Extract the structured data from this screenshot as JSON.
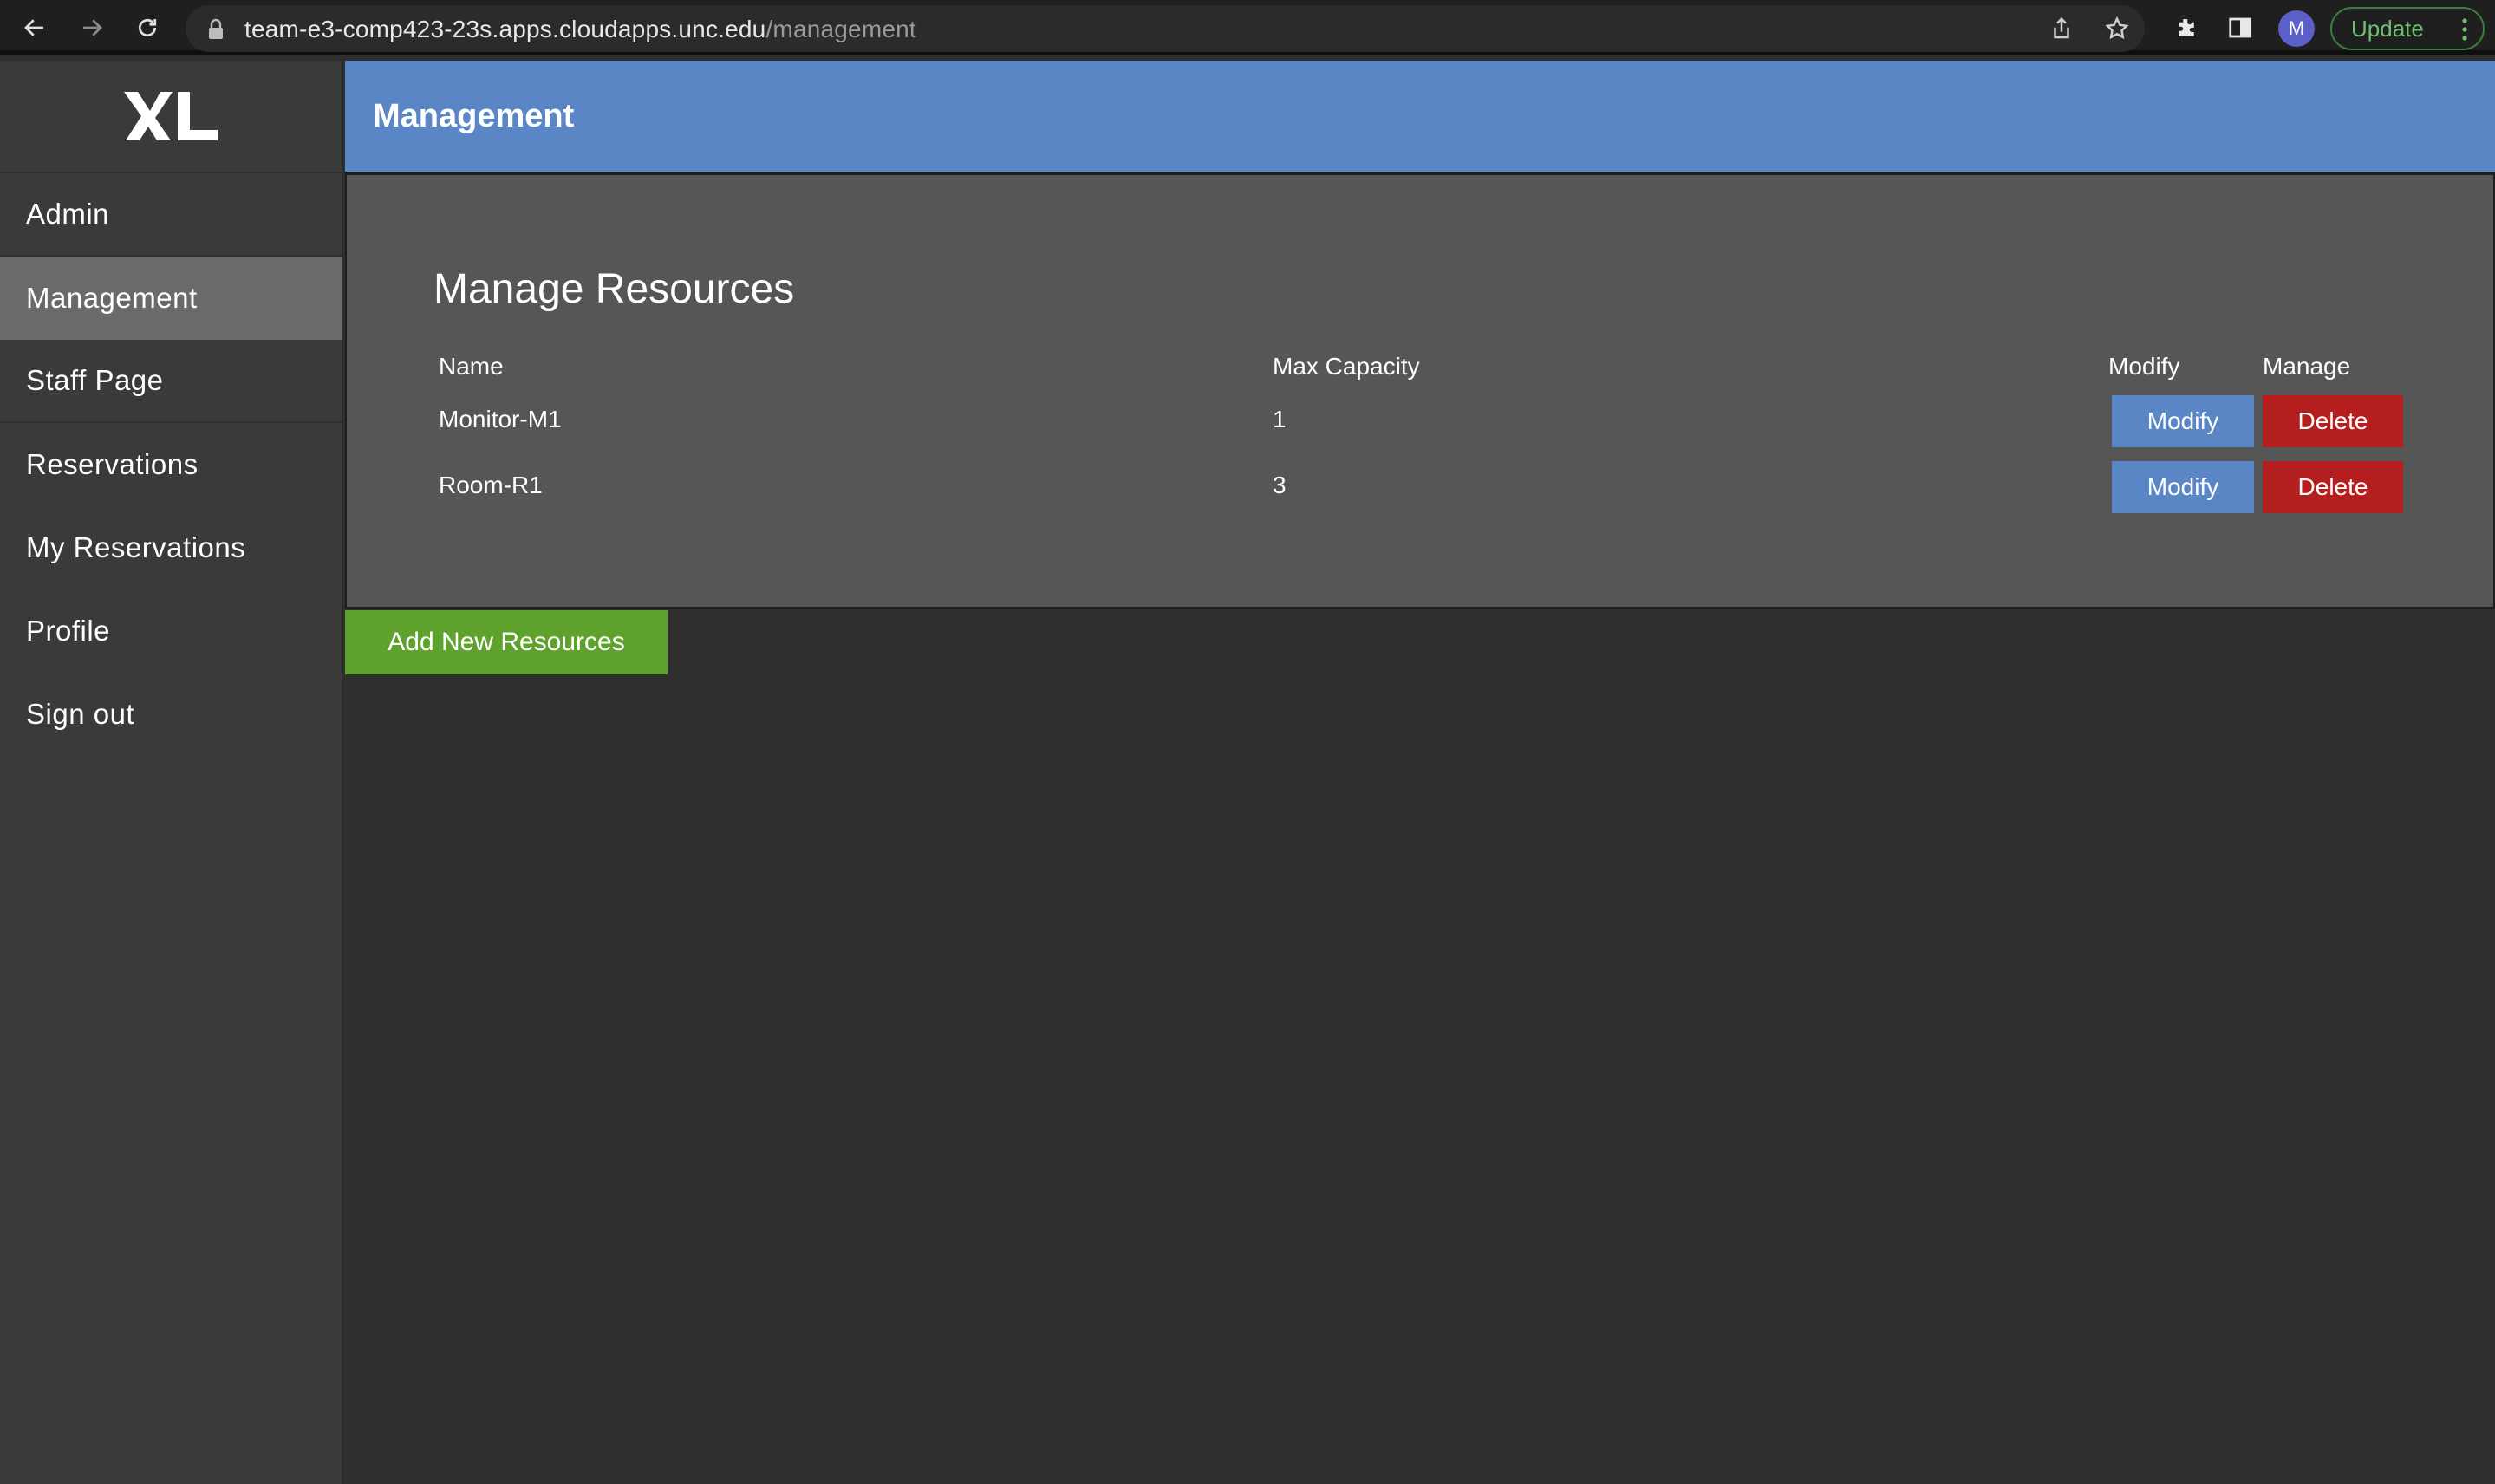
{
  "browser": {
    "url_host": "team-e3-comp423-23s.apps.cloudapps.unc.edu",
    "url_path": "/management",
    "profile_initial": "M",
    "update_label": "Update"
  },
  "sidebar": {
    "logo_icon": "xl-logo-icon",
    "items": [
      {
        "label": "Admin"
      },
      {
        "label": "Management",
        "active": true
      },
      {
        "label": "Staff Page"
      },
      {
        "label": "Reservations"
      },
      {
        "label": "My Reservations"
      },
      {
        "label": "Profile"
      },
      {
        "label": "Sign out"
      }
    ]
  },
  "header": {
    "title": "Management"
  },
  "main": {
    "title": "Manage Resources",
    "columns": [
      "Name",
      "Max Capacity",
      "Modify",
      "Manage"
    ],
    "rows": [
      {
        "name": "Monitor-M1",
        "max_capacity": "1",
        "modify_label": "Modify",
        "delete_label": "Delete"
      },
      {
        "name": "Room-R1",
        "max_capacity": "3",
        "modify_label": "Modify",
        "delete_label": "Delete"
      }
    ],
    "add_button_label": "Add New Resources"
  },
  "colors": {
    "header_bg": "#5a86c5",
    "modify_button": "#5a86c5",
    "delete_button": "#b51e1e",
    "add_button": "#5ea12c",
    "sidebar_bg": "#3a3a3a",
    "sidebar_active": "#6a6a6a",
    "card_bg": "#565656",
    "page_bg": "#2f2f2f"
  }
}
